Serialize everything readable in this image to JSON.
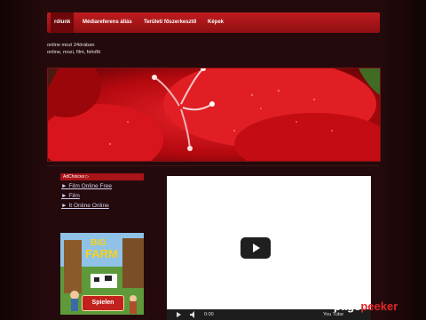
{
  "nav": {
    "items": [
      {
        "label": "rólunk",
        "active": true
      },
      {
        "label": "Médiareferens állás",
        "active": false
      },
      {
        "label": "Területi főszerkesztő",
        "active": false
      },
      {
        "label": "Képek",
        "active": false
      }
    ]
  },
  "header": {
    "site_title": "online mozi 24órában",
    "keywords": "online, mozi, film, felnőtt"
  },
  "sidebar": {
    "adchoices_label": "AdChoices ▷",
    "ad_links": [
      "► Film Online Free",
      "► Film",
      "► It Online Online"
    ],
    "game_ad": {
      "logo_top": "BIG",
      "logo_bottom": "FARM",
      "button_label": "Spielen"
    }
  },
  "video": {
    "time": "0:00",
    "youtube_label": "You Tube"
  },
  "watermark": {
    "page": "page",
    "peeker": "peeker"
  },
  "colors": {
    "accent": "#b0181c",
    "background": "#1b0708"
  }
}
